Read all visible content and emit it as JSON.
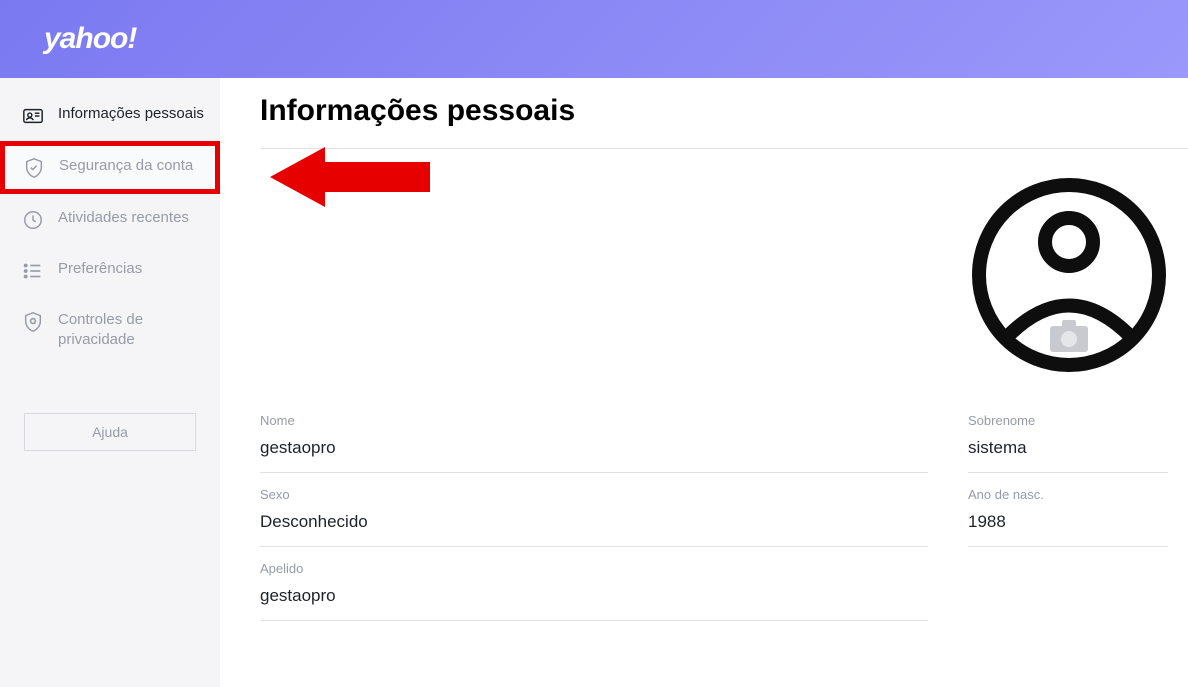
{
  "header": {
    "logo": "yahoo!"
  },
  "sidebar": {
    "items": [
      {
        "label": "Informações pessoais"
      },
      {
        "label": "Segurança da conta"
      },
      {
        "label": "Atividades recentes"
      },
      {
        "label": "Preferências"
      },
      {
        "label": "Controles de privacidade"
      }
    ],
    "help": "Ajuda"
  },
  "main": {
    "title": "Informações pessoais",
    "fields": {
      "nome_label": "Nome",
      "nome_value": "gestaopro",
      "sobrenome_label": "Sobrenome",
      "sobrenome_value": "sistema",
      "sexo_label": "Sexo",
      "sexo_value": "Desconhecido",
      "ano_label": "Ano de nasc.",
      "ano_value": "1988",
      "apelido_label": "Apelido",
      "apelido_value": "gestaopro"
    }
  }
}
